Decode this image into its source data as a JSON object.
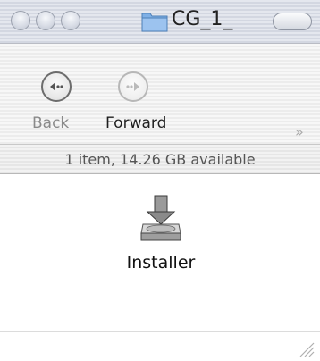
{
  "window": {
    "title": "CG_1_",
    "buttons": [
      "close-icon",
      "minimize-icon",
      "zoom-icon"
    ],
    "toolbar_toggle_icon": "toolbar-toggle-icon"
  },
  "toolbar": {
    "back_label": "Back",
    "forward_label": "Forward",
    "back_icon": "back-arrow-icon",
    "forward_icon": "forward-arrow-icon",
    "more_icon": "chevron-more-icon"
  },
  "status": {
    "text": "1 item, 14.26 GB available"
  },
  "content": {
    "items": [
      {
        "name": "Installer",
        "icon": "installer-icon"
      }
    ]
  }
}
